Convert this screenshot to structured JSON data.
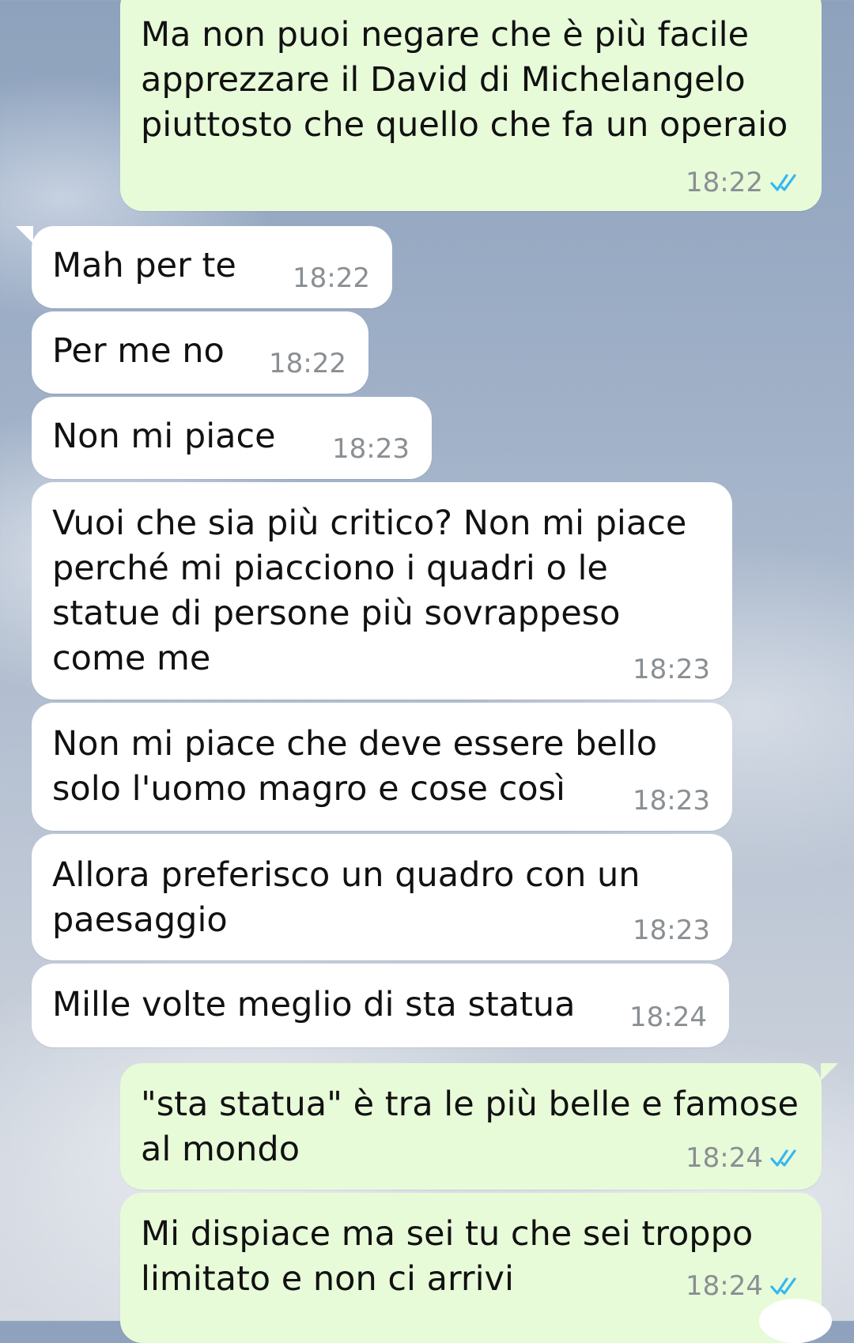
{
  "messages": [
    {
      "direction": "out",
      "text": "Ma non puoi negare che è più facile\napprezzare il David di Michelangelo\npiuttosto che quello che fa un operaio",
      "time": "18:22",
      "read": true
    },
    {
      "direction": "in",
      "text": "Mah per te",
      "time": "18:22"
    },
    {
      "direction": "in",
      "text": "Per me no",
      "time": "18:22"
    },
    {
      "direction": "in",
      "text": "Non mi piace",
      "time": "18:23"
    },
    {
      "direction": "in",
      "text": "Vuoi che sia più critico? Non mi piace\nperché mi piacciono i quadri o le\nstatue di persone più sovrappeso\ncome me",
      "time": "18:23"
    },
    {
      "direction": "in",
      "text": "Non mi piace che deve essere bello\nsolo l'uomo magro e cose così",
      "time": "18:23"
    },
    {
      "direction": "in",
      "text": "Allora preferisco un quadro con un\npaesaggio",
      "time": "18:23"
    },
    {
      "direction": "in",
      "text": "Mille volte meglio di sta statua",
      "time": "18:24"
    },
    {
      "direction": "out",
      "text": "\"sta statua\" è tra le più belle e famose\nal mondo",
      "time": "18:24",
      "read": true
    },
    {
      "direction": "out",
      "text": "Mi dispiace ma sei tu che sei troppo\nlimitato e non ci arrivi",
      "time": "18:24",
      "read": true
    }
  ],
  "colors": {
    "incoming_bubble": "#ffffff",
    "outgoing_bubble": "#e8fbd9",
    "read_tick": "#34b7f1",
    "timestamp": "#8a8f93"
  },
  "icons": {
    "read_receipt": "double-check-icon"
  }
}
